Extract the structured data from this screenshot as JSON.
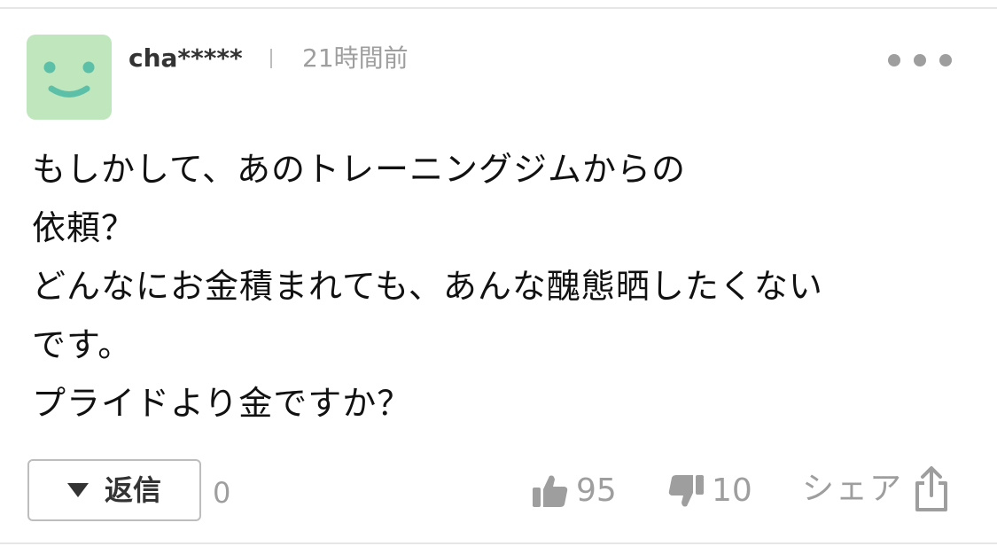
{
  "comment": {
    "username": "cha*****",
    "timestamp": "21時間前",
    "lines": [
      "もしかして、あのトレーニングジムからの",
      "依頼？",
      "どんなにお金積まれても、あんな醜態晒したくない",
      "です。",
      "プライドより金ですか？"
    ]
  },
  "actions": {
    "reply_label": "返信",
    "reply_count": "0",
    "like_count": "95",
    "dislike_count": "10",
    "share_label": "シェア"
  },
  "icons": {
    "avatar": "smiley-face-icon",
    "more": "more-dots-icon",
    "reply": "triangle-down-icon",
    "like": "thumbs-up-icon",
    "dislike": "thumbs-down-icon",
    "share": "share-icon"
  },
  "colors": {
    "avatar_bg": "#bfe6bd",
    "avatar_face": "#5cc0a8",
    "muted_text": "#9e9e9e",
    "body_text": "#111111",
    "border": "#bdbdbd"
  }
}
